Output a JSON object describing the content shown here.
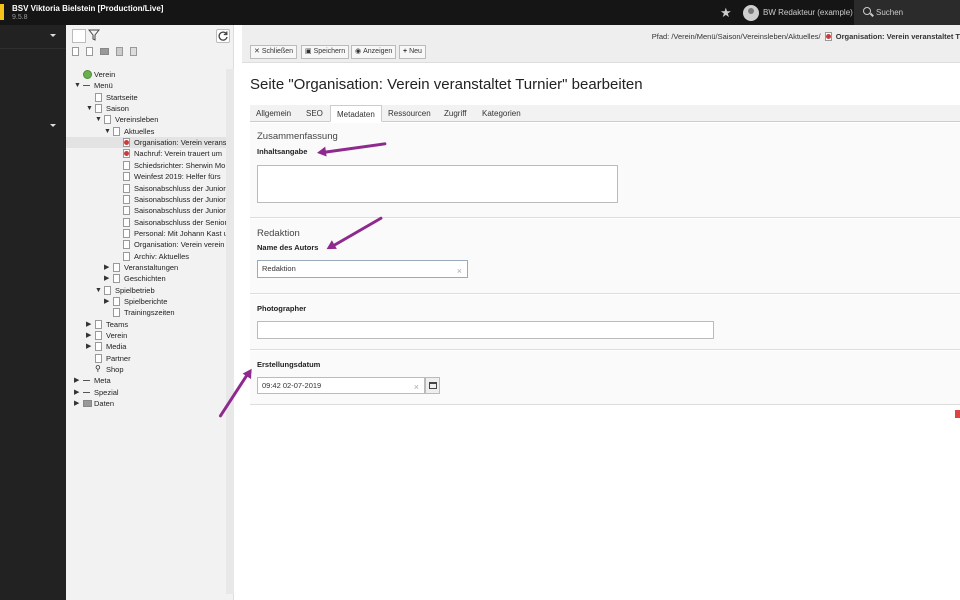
{
  "topbar": {
    "site_name": "BSV Viktoria Bielstein [Production/Live]",
    "site_version": "9.5.8",
    "user_name": "BW Redakteur (example)",
    "search_label": "Suchen"
  },
  "tree": [
    {
      "label": "Verein",
      "depth": 0,
      "toggle": "",
      "icon": "globe"
    },
    {
      "label": "Menü",
      "depth": 0,
      "toggle": "▼",
      "icon": "menu"
    },
    {
      "label": "Startseite",
      "depth": 1,
      "toggle": "",
      "icon": "page"
    },
    {
      "label": "Saison",
      "depth": 1,
      "toggle": "▼",
      "icon": "page"
    },
    {
      "label": "Vereinsleben",
      "depth": 2,
      "toggle": "▼",
      "icon": "page"
    },
    {
      "label": "Aktuelles",
      "depth": 3,
      "toggle": "▼",
      "icon": "page"
    },
    {
      "label": "Organisation: Verein veranst",
      "depth": 4,
      "toggle": "",
      "icon": "red",
      "active": true
    },
    {
      "label": "Nachruf: Verein trauert um",
      "depth": 4,
      "toggle": "",
      "icon": "red"
    },
    {
      "label": "Schiedsrichter: Sherwin Mo",
      "depth": 4,
      "toggle": "",
      "icon": "page"
    },
    {
      "label": "Weinfest 2019: Helfer fürs",
      "depth": 4,
      "toggle": "",
      "icon": "page"
    },
    {
      "label": "Saisonabschluss der Juniore",
      "depth": 4,
      "toggle": "",
      "icon": "page"
    },
    {
      "label": "Saisonabschluss der Juniore",
      "depth": 4,
      "toggle": "",
      "icon": "page"
    },
    {
      "label": "Saisonabschluss der Juniore",
      "depth": 4,
      "toggle": "",
      "icon": "page"
    },
    {
      "label": "Saisonabschluss der Senior",
      "depth": 4,
      "toggle": "",
      "icon": "page"
    },
    {
      "label": "Personal: Mit Johann Kast u",
      "depth": 4,
      "toggle": "",
      "icon": "page"
    },
    {
      "label": "Organisation: Verein verein",
      "depth": 4,
      "toggle": "",
      "icon": "page"
    },
    {
      "label": "Archiv: Aktuelles",
      "depth": 4,
      "toggle": "",
      "icon": "page"
    },
    {
      "label": "Veranstaltungen",
      "depth": 3,
      "toggle": "▶",
      "icon": "page"
    },
    {
      "label": "Geschichten",
      "depth": 3,
      "toggle": "▶",
      "icon": "page"
    },
    {
      "label": "Spielbetrieb",
      "depth": 2,
      "toggle": "▼",
      "icon": "page"
    },
    {
      "label": "Spielberichte",
      "depth": 3,
      "toggle": "▶",
      "icon": "page"
    },
    {
      "label": "Trainingszeiten",
      "depth": 3,
      "toggle": "",
      "icon": "page"
    },
    {
      "label": "Teams",
      "depth": 1,
      "toggle": "▶",
      "icon": "page"
    },
    {
      "label": "Verein",
      "depth": 1,
      "toggle": "▶",
      "icon": "page"
    },
    {
      "label": "Media",
      "depth": 1,
      "toggle": "▶",
      "icon": "page"
    },
    {
      "label": "Partner",
      "depth": 1,
      "toggle": "",
      "icon": "page"
    },
    {
      "label": "Shop",
      "depth": 1,
      "toggle": "",
      "icon": "link"
    },
    {
      "label": "Meta",
      "depth": 0,
      "toggle": "▶",
      "icon": "menu"
    },
    {
      "label": "Spezial",
      "depth": 0,
      "toggle": "▶",
      "icon": "menu"
    },
    {
      "label": "Daten",
      "depth": 0,
      "toggle": "▶",
      "icon": "folder"
    }
  ],
  "header": {
    "path_prefix": "Pfad: /Verein/Menü/Saison/Vereinsleben/Aktuelles/",
    "path_page": "Organisation: Verein veranstaltet T",
    "buttons": [
      {
        "icon": "✕",
        "label": "Schließen"
      },
      {
        "icon": "▣",
        "label": "Speichern"
      },
      {
        "icon": "◉",
        "label": "Anzeigen"
      },
      {
        "icon": "+",
        "label": "Neu"
      }
    ]
  },
  "page_heading": "Seite \"Organisation: Verein veranstaltet Turnier\" bearbeiten",
  "tabs": [
    "Allgemein",
    "SEO",
    "Metadaten",
    "Ressourcen",
    "Zugriff",
    "Kategorien"
  ],
  "active_tab": "Metadaten",
  "form": {
    "summary_title": "Zusammenfassung",
    "abstract_label": "Inhaltsangabe",
    "abstract_value": "",
    "editorial_title": "Redaktion",
    "author_label": "Name des Autors",
    "author_value": "Redaktion",
    "photographer_label": "Photographer",
    "photographer_value": "",
    "created_label": "Erstellungsdatum",
    "created_value": "09:42 02-07-2019"
  },
  "colors": {
    "annotation_arrow": "#8e2a8e",
    "topbar": "#151515"
  }
}
